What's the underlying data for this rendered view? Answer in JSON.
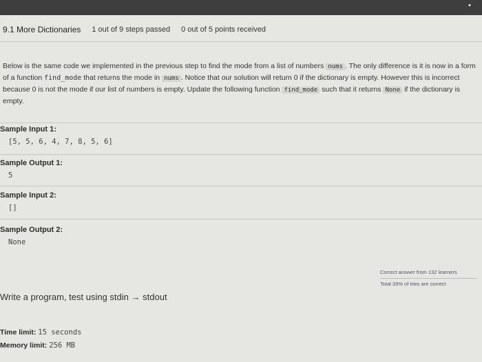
{
  "header": {
    "title": "9.1 More Dictionaries",
    "steps": "1 out of 9 steps passed",
    "points": "0 out of 5 points received"
  },
  "description": {
    "p1": "Below is the same code we implemented in the previous step to find the mode from a list of numbers",
    "code_nums_1": "nums",
    "p2": ". The only difference is it is now in a form of a function",
    "code_find_mode_1": "find_mode",
    "p3": "that returns the mode in",
    "code_nums_2": "nums",
    "p4": ". Notice that our solution will return 0 if the dictionary is empty. However this is incorrect because 0 is not the mode if our list of numbers is empty. Update the following function",
    "code_find_mode_2": "find_mode",
    "p5": "such that it returns",
    "code_none": "None",
    "p6": "if the dictionary is empty."
  },
  "samples": [
    {
      "label": "Sample Input 1:",
      "value": "[5, 5, 6, 4, 7, 8, 5, 6]"
    },
    {
      "label": "Sample Output 1:",
      "value": "5"
    },
    {
      "label": "Sample Input 2:",
      "value": "[]"
    },
    {
      "label": "Sample Output 2:",
      "value": "None"
    }
  ],
  "stats": {
    "correct": "Correct answer from 132 learners",
    "total": "Total 39% of tries are correct"
  },
  "write_program": {
    "text": "Write a program, test using stdin",
    "arrow": "→",
    "suffix": "stdout"
  },
  "limits": {
    "time_label": "Time limit:",
    "time_value": "15 seconds",
    "memory_label": "Memory limit:",
    "memory_value": "256 MB"
  }
}
